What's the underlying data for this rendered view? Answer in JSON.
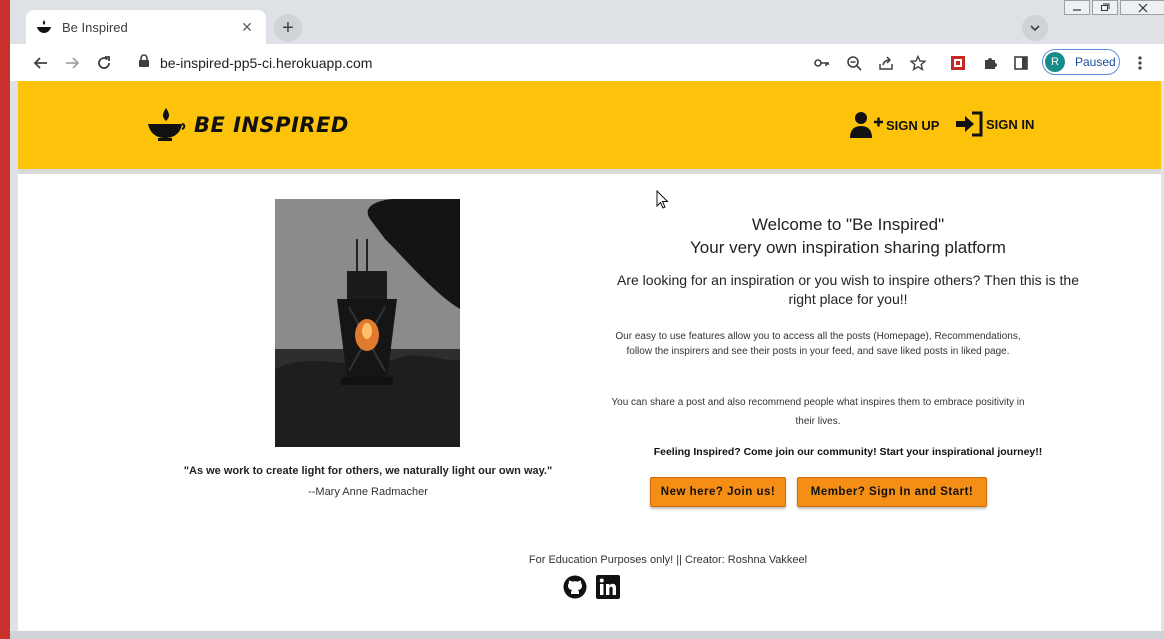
{
  "browser": {
    "tab_title": "Be Inspired",
    "tab_close": "✕",
    "new_tab": "+",
    "url": "be-inspired-pp5-ci.herokuapp.com",
    "profile_initial": "R",
    "profile_status": "Paused"
  },
  "header": {
    "brand": "BE INSPIRED",
    "signup": "SIGN UP",
    "signin": "SIGN IN"
  },
  "hero": {
    "quote": "\"As we work to create light for others, we naturally light our own way.\"",
    "author": "--Mary Anne Radmacher"
  },
  "intro": {
    "welcome_line1": "Welcome to \"Be Inspired\"",
    "welcome_line2": "Your very own inspiration sharing platform",
    "lead": "Are looking for an inspiration or you wish to inspire others? Then this is the right place for you!!",
    "para1": "Our easy to use features allow you to access all the posts (Homepage), Recommendations, follow the inspirers and see their posts in your feed, and save liked posts in liked page.",
    "para2": "You can share a post and also recommend people what inspires them to embrace positivity in their lives.",
    "cta": "Feeling Inspired? Come join our community! Start your inspirational journey!!",
    "join_button": "New here? Join us!",
    "signin_button": "Member? Sign In and Start!"
  },
  "footer": {
    "text": "For Education Purposes only! || Creator: Roshna Vakkeel"
  },
  "colors": {
    "header_bg": "#fcc30a",
    "button_bg": "#f58e14",
    "profile_avatar": "#188b8b"
  }
}
